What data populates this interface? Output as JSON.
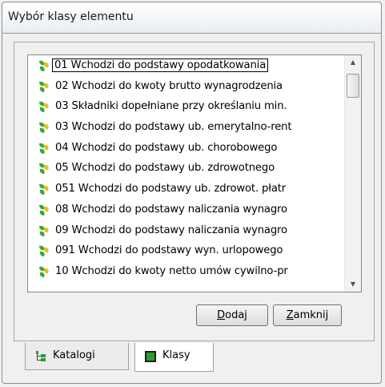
{
  "window": {
    "title": "Wybór klasy elementu"
  },
  "list": {
    "items": [
      "01 Wchodzi do podstawy opodatkowania",
      "02 Wchodzi do kwoty brutto wynagrodzenia",
      "03 Składniki dopełniane przy określaniu min.",
      "03 Wchodzi do podstawy ub. emerytalno-rent",
      "04 Wchodzi do podstawy ub. chorobowego",
      "05 Wchodzi do podstawy ub. zdrowotnego",
      "051 Wchodzi do podstawy ub. zdrowot. płatr",
      "08 Wchodzi do podstawy naliczania wynagro",
      "09 Wchodzi do podstawy naliczania wynagro",
      "091 Wchodzi do podstawy wyn. urlopowego",
      "10 Wchodzi do kwoty netto umów cywilno-pr"
    ],
    "selected_index": 0
  },
  "buttons": {
    "add_accel": "D",
    "add_rest": "odaj",
    "close_accel": "Z",
    "close_rest": "amknij"
  },
  "tabs": {
    "katalogi": "Katalogi",
    "klasy": "Klasy",
    "active": "klasy"
  },
  "colors": {
    "icon_green": "#3aa83a",
    "icon_yellow": "#e6c21a",
    "tab_green": "#2e9b2e"
  }
}
